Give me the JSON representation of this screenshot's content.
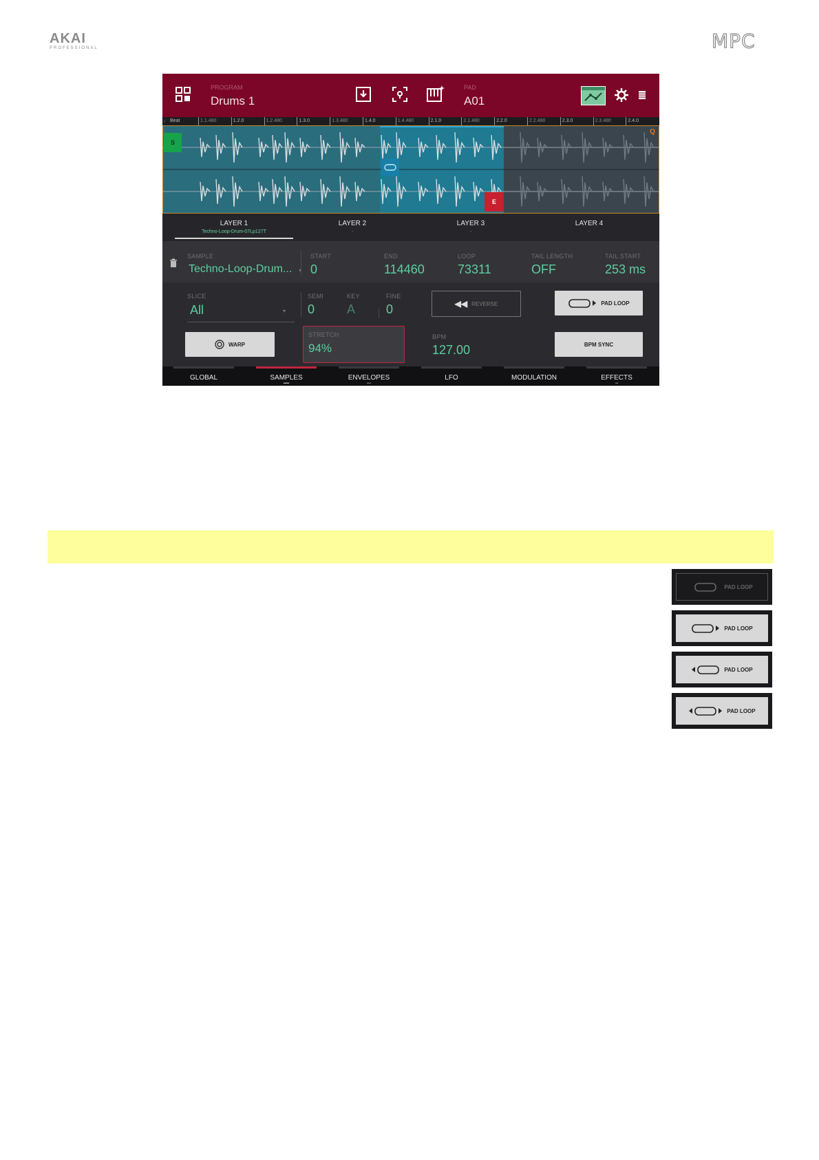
{
  "page": {
    "brand_left": "AKAI",
    "brand_left_sub": "PROFESSIONAL",
    "brand_right": "MPC"
  },
  "screen": {
    "topbar": {
      "program_label": "PROGRAM",
      "program_name": "Drums 1",
      "pad_label": "PAD",
      "pad_name": "A01"
    },
    "ruler": {
      "beat_label": "Beat",
      "ticks": [
        "1.1.480",
        "1.2.0",
        "1.2.480",
        "1.3.0",
        "1.3.480",
        "1.4.0",
        "1.4.480",
        "2.1.0",
        "2.1.480",
        "2.2.0",
        "2.2.480",
        "2.3.0",
        "2.3.480",
        "2.4.0"
      ],
      "q_label": "Q"
    },
    "wave": {
      "start_marker": "S",
      "end_marker": "E"
    },
    "layers": [
      {
        "name": "LAYER 1",
        "sample": "Techno-Loop-Drum-07Lp127T",
        "active": true
      },
      {
        "name": "LAYER 2",
        "sample": "-",
        "active": false
      },
      {
        "name": "LAYER 3",
        "sample": "-",
        "active": false
      },
      {
        "name": "LAYER 4",
        "sample": "-",
        "active": false
      }
    ],
    "params1": {
      "sample_label": "SAMPLE",
      "sample_value": "Techno-Loop-Drum...",
      "start_label": "START",
      "start_value": "0",
      "end_label": "END",
      "end_value": "114460",
      "loop_label": "LOOP",
      "loop_value": "73311",
      "tail_length_label": "TAIL LENGTH",
      "tail_length_value": "OFF",
      "tail_start_label": "TAIL START",
      "tail_start_value": "253 ms"
    },
    "params2": {
      "slice_label": "SLICE",
      "slice_value": "All",
      "semi_label": "SEMI",
      "semi_value": "0",
      "key_label": "KEY",
      "key_value": "A",
      "fine_label": "FINE",
      "fine_value": "0",
      "reverse_label": "REVERSE",
      "pad_loop_label": "PAD LOOP",
      "warp_label": "WARP",
      "stretch_label": "STRETCH",
      "stretch_value": "94%",
      "bpm_label": "BPM",
      "bpm_value": "127.00",
      "bpm_sync_label": "BPM SYNC"
    },
    "tabs": [
      {
        "label": "GLOBAL",
        "active": false,
        "dots": ""
      },
      {
        "label": "SAMPLES",
        "active": true,
        "dots": "▪▪▪▪"
      },
      {
        "label": "ENVELOPES",
        "active": false,
        "dots": "▪▪▪"
      },
      {
        "label": "LFO",
        "active": false,
        "dots": ""
      },
      {
        "label": "MODULATION",
        "active": false,
        "dots": ""
      },
      {
        "label": "EFFECTS",
        "active": false,
        "dots": "▪▪"
      }
    ]
  },
  "pad_loop_states": [
    {
      "label": "PAD LOOP",
      "state": "off"
    },
    {
      "label": "PAD LOOP",
      "state": "forward"
    },
    {
      "label": "PAD LOOP",
      "state": "reverse"
    },
    {
      "label": "PAD LOOP",
      "state": "alternating"
    }
  ],
  "colors": {
    "topbar": "#7c0627",
    "accent_green": "#5dcfa0",
    "wave_active": "#1f6f83",
    "start_marker": "#17a34a",
    "end_marker": "#c8202f",
    "highlight": "#fefe9c"
  }
}
